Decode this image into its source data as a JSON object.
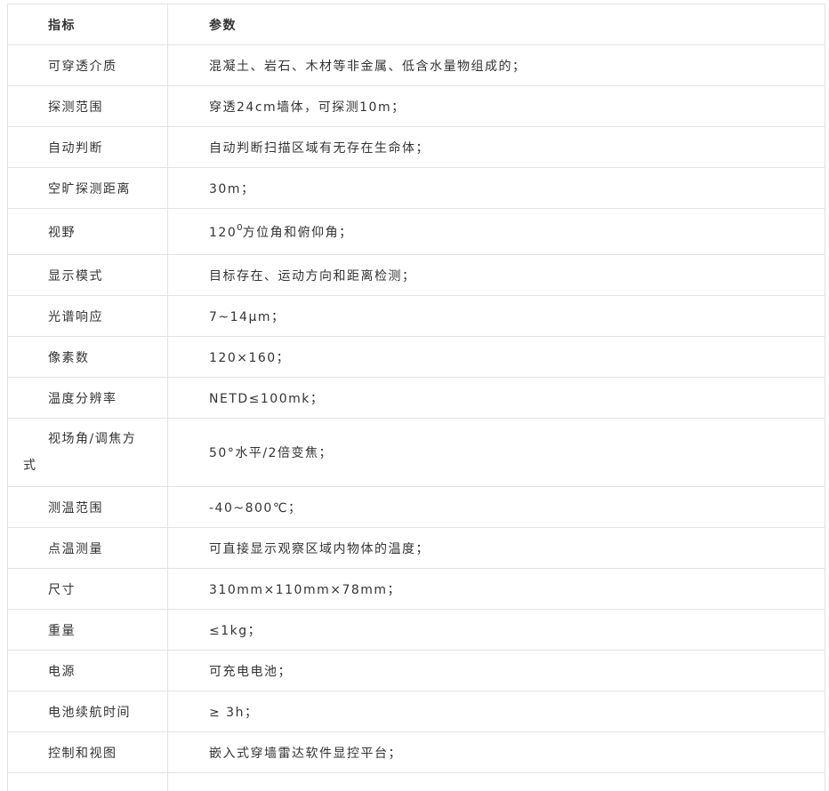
{
  "table": {
    "header": {
      "name": "指标",
      "value": "参数"
    },
    "rows": [
      {
        "name": "可穿透介质",
        "value": "混凝土、岩石、木材等非金属、低含水量物组成的；"
      },
      {
        "name": "探测范围",
        "value": "穿透24cm墙体，可探测10m；"
      },
      {
        "name": "自动判断",
        "value": "自动判断扫描区域有无存在生命体；"
      },
      {
        "name": "空旷探测距离",
        "value": "30m；"
      },
      {
        "name": "视野",
        "value_prefix": "120",
        "value_sup": "0",
        "value_suffix": "方位角和俯仰角；"
      },
      {
        "name": "显示模式",
        "value": "目标存在、运动方向和距离检测；"
      },
      {
        "name": "光谱响应",
        "value": "7~14μm；"
      },
      {
        "name": "像素数",
        "value": "120×160；"
      },
      {
        "name": "温度分辨率",
        "value": "NETD≤100mk；"
      },
      {
        "name": "视场角/调焦方式",
        "value": "50°水平/2倍变焦；"
      },
      {
        "name": "测温范围",
        "value": "-40~800℃；"
      },
      {
        "name": "点温测量",
        "value": "可直接显示观察区域内物体的温度；"
      },
      {
        "name": "尺寸",
        "value": "310mm×110mm×78mm；"
      },
      {
        "name": "重量",
        "value": "≤1kg；"
      },
      {
        "name": "电源",
        "value": "可充电电池；"
      },
      {
        "name": "电池续航时间",
        "value": "≥ 3h；"
      },
      {
        "name": "控制和视图",
        "value": "嵌入式穿墙雷达软件显控平台；"
      }
    ]
  }
}
